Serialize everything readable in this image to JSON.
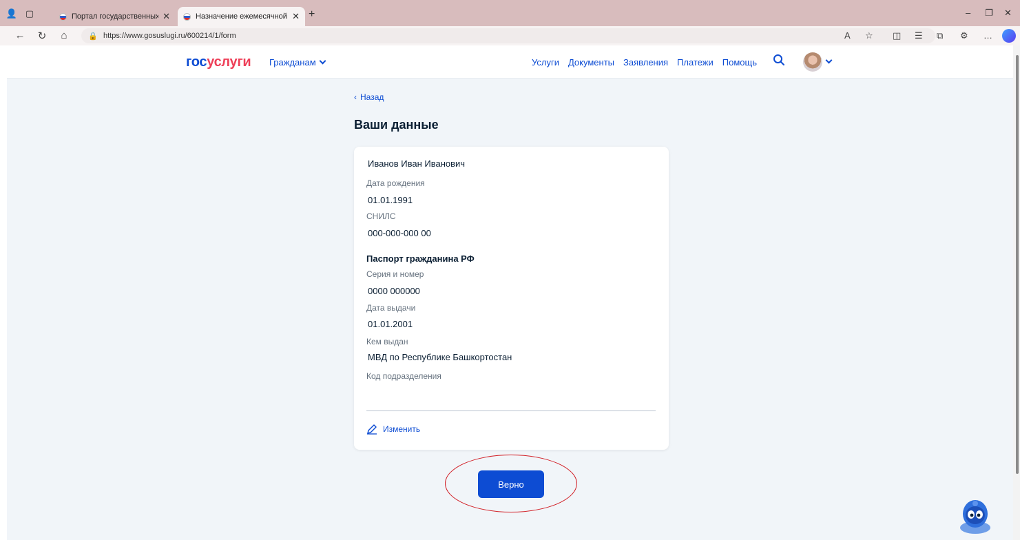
{
  "browser": {
    "tabs": [
      {
        "title": "Портал государственных услуг Р"
      },
      {
        "title": "Назначение ежемесячной выпл"
      }
    ],
    "url": "https://www.gosuslugi.ru/600214/1/form"
  },
  "header": {
    "logo_part1": "гос",
    "logo_part2": "услуги",
    "citizens_label": "Гражданам",
    "nav": [
      "Услуги",
      "Документы",
      "Заявления",
      "Платежи",
      "Помощь"
    ]
  },
  "page": {
    "back_label": "Назад",
    "title": "Ваши данные"
  },
  "person": {
    "full_name": "Иванов Иван Иванович",
    "birth_date_label": "Дата рождения",
    "birth_date": "01.01.1991",
    "snils_label": "СНИЛС",
    "snils": "000-000-000 00"
  },
  "passport": {
    "section_title": "Паспорт гражданина РФ",
    "series_label": "Серия и номер",
    "series_value": "0000 000000",
    "issue_date_label": "Дата выдачи",
    "issue_date": "01.01.2001",
    "issued_by_label": "Кем выдан",
    "issued_by": "МВД по Республике Башкортостан",
    "subdivision_label": "Код подразделения",
    "subdivision_value": ""
  },
  "actions": {
    "edit_label": "Изменить",
    "confirm_label": "Верно"
  },
  "colors": {
    "brand_blue": "#0d4cd3",
    "brand_red": "#ee3f58",
    "annotation_red": "#d21f26"
  }
}
